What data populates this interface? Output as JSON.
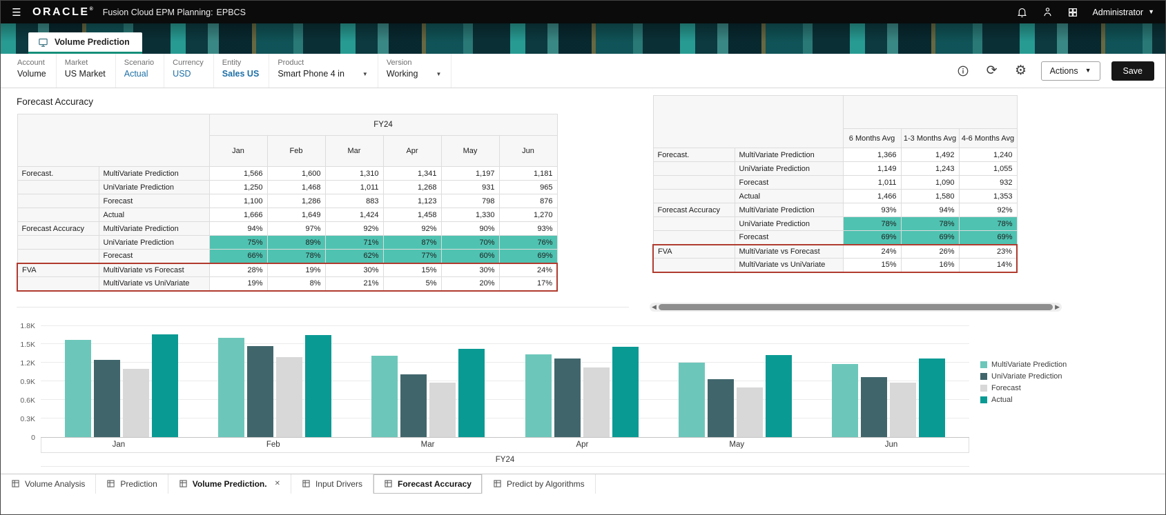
{
  "header": {
    "brand": "ORACLE",
    "registered": "®",
    "app_label": "Fusion Cloud EPM Planning:",
    "app_env": "EPBCS",
    "user_name": "Administrator"
  },
  "main_tab": {
    "label": "Volume Prediction"
  },
  "pov": {
    "items": [
      {
        "label": "Account",
        "value": "Volume",
        "style": "plain"
      },
      {
        "label": "Market",
        "value": "US Market",
        "style": "plain"
      },
      {
        "label": "Scenario",
        "value": "Actual",
        "style": "link"
      },
      {
        "label": "Currency",
        "value": "USD",
        "style": "link"
      },
      {
        "label": "Entity",
        "value": "Sales US",
        "style": "link-bold"
      },
      {
        "label": "Product",
        "value": "Smart Phone 4 in",
        "style": "plain",
        "dropdown": true
      },
      {
        "label": "Version",
        "value": "Working",
        "style": "plain",
        "dropdown": true
      }
    ],
    "actions_label": "Actions",
    "save_label": "Save"
  },
  "page_title": "Forecast Accuracy",
  "colors": {
    "highlight": "#4fc2b1",
    "fva_border": "#b03a2e",
    "tab_underline": "#158f79",
    "link": "#1d6fa5"
  },
  "grids": {
    "left": {
      "year_header": "FY24",
      "columns": [
        "Jan",
        "Feb",
        "Mar",
        "Apr",
        "May",
        "Jun"
      ],
      "rows": [
        {
          "group": "Forecast.",
          "member": "MultiVariate Prediction",
          "values": [
            "1,566",
            "1,600",
            "1,310",
            "1,341",
            "1,197",
            "1,181"
          ]
        },
        {
          "group": "",
          "member": "UniVariate Prediction",
          "values": [
            "1,250",
            "1,468",
            "1,011",
            "1,268",
            "931",
            "965"
          ]
        },
        {
          "group": "",
          "member": "Forecast",
          "values": [
            "1,100",
            "1,286",
            "883",
            "1,123",
            "798",
            "876"
          ]
        },
        {
          "group": "",
          "member": "Actual",
          "values": [
            "1,666",
            "1,649",
            "1,424",
            "1,458",
            "1,330",
            "1,270"
          ]
        },
        {
          "group": "Forecast Accuracy",
          "member": "MultiVariate Prediction",
          "values": [
            "94%",
            "97%",
            "92%",
            "92%",
            "90%",
            "93%"
          ]
        },
        {
          "group": "",
          "member": "UniVariate Prediction",
          "values": [
            "75%",
            "89%",
            "71%",
            "87%",
            "70%",
            "76%"
          ],
          "highlight": true
        },
        {
          "group": "",
          "member": "Forecast",
          "values": [
            "66%",
            "78%",
            "62%",
            "77%",
            "60%",
            "69%"
          ],
          "highlight": true
        },
        {
          "group": "FVA",
          "member": "MultiVariate vs Forecast",
          "values": [
            "28%",
            "19%",
            "30%",
            "15%",
            "30%",
            "24%"
          ],
          "fva": true
        },
        {
          "group": "",
          "member": "MultiVariate vs UniVariate",
          "values": [
            "19%",
            "8%",
            "21%",
            "5%",
            "20%",
            "17%"
          ],
          "fva": true
        }
      ]
    },
    "right": {
      "columns": [
        "6 Months Avg",
        "1-3 Months Avg",
        "4-6 Months Avg"
      ],
      "rows": [
        {
          "group": "Forecast.",
          "member": "MultiVariate Prediction",
          "values": [
            "1,366",
            "1,492",
            "1,240"
          ]
        },
        {
          "group": "",
          "member": "UniVariate Prediction",
          "values": [
            "1,149",
            "1,243",
            "1,055"
          ]
        },
        {
          "group": "",
          "member": "Forecast",
          "values": [
            "1,011",
            "1,090",
            "932"
          ]
        },
        {
          "group": "",
          "member": "Actual",
          "values": [
            "1,466",
            "1,580",
            "1,353"
          ]
        },
        {
          "group": "Forecast Accuracy",
          "member": "MultiVariate Prediction",
          "values": [
            "93%",
            "94%",
            "92%"
          ]
        },
        {
          "group": "",
          "member": "UniVariate Prediction",
          "values": [
            "78%",
            "78%",
            "78%"
          ],
          "highlight": true
        },
        {
          "group": "",
          "member": "Forecast",
          "values": [
            "69%",
            "69%",
            "69%"
          ],
          "highlight": true
        },
        {
          "group": "FVA",
          "member": "MultiVariate vs Forecast",
          "values": [
            "24%",
            "26%",
            "23%"
          ],
          "fva": true
        },
        {
          "group": "",
          "member": "MultiVariate vs UniVariate",
          "values": [
            "15%",
            "16%",
            "14%"
          ],
          "fva": true
        }
      ]
    }
  },
  "chart_data": {
    "type": "bar",
    "categories": [
      "Jan",
      "Feb",
      "Mar",
      "Apr",
      "May",
      "Jun"
    ],
    "series": [
      {
        "name": "MultiVariate Prediction",
        "color": "#6cc7ba",
        "values": [
          1566,
          1600,
          1310,
          1341,
          1197,
          1181
        ]
      },
      {
        "name": "UniVariate Prediction",
        "color": "#40666c",
        "values": [
          1250,
          1468,
          1011,
          1268,
          931,
          965
        ]
      },
      {
        "name": "Forecast",
        "color": "#d8d8d8",
        "values": [
          1100,
          1286,
          883,
          1123,
          798,
          876
        ]
      },
      {
        "name": "Actual",
        "color": "#0a9a94",
        "values": [
          1666,
          1649,
          1424,
          1458,
          1330,
          1270
        ]
      }
    ],
    "xlabel": "FY24",
    "ylabel": "",
    "ylim": [
      0,
      1800
    ],
    "yticks": [
      "0",
      "0.3K",
      "0.6K",
      "0.9K",
      "1.2K",
      "1.5K",
      "1.8K"
    ],
    "grid": true,
    "legend_position": "right"
  },
  "bottom_tabs": [
    {
      "label": "Volume Analysis"
    },
    {
      "label": "Prediction"
    },
    {
      "label": "Volume Prediction.",
      "active": true,
      "closable": true
    },
    {
      "label": "Input Drivers"
    },
    {
      "label": "Forecast Accuracy",
      "selected": true
    },
    {
      "label": "Predict by Algorithms"
    }
  ]
}
